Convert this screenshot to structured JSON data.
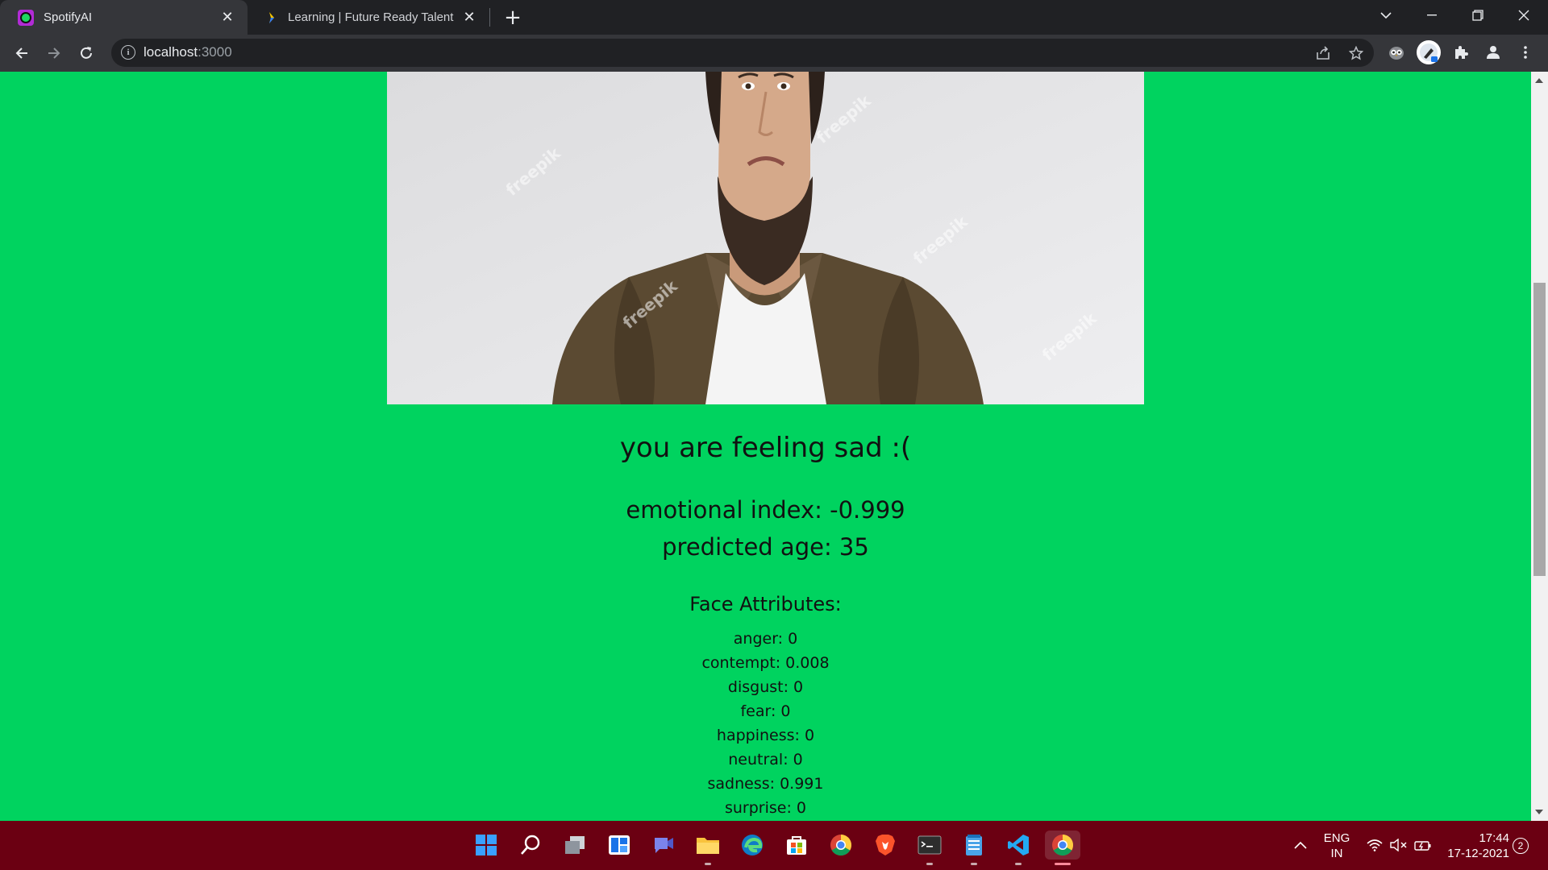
{
  "browser": {
    "tabs": [
      {
        "title": "SpotifyAI",
        "active": true,
        "favicon": "spotify-ai-icon"
      },
      {
        "title": "Learning | Future Ready Talent",
        "active": false,
        "favicon": "learning-icon"
      }
    ],
    "address": {
      "host": "localhost",
      "port": ":3000"
    }
  },
  "page": {
    "image": {
      "description_icon": "sad-man-photo",
      "watermark": "freepik"
    },
    "feeling": "you are feeling sad :(",
    "emotional_index": "emotional index: -0.999",
    "predicted_age": "predicted age: 35",
    "attributes_title": "Face Attributes:",
    "attributes": [
      "anger: 0",
      "contempt: 0.008",
      "disgust: 0",
      "fear: 0",
      "happiness: 0",
      "neutral: 0",
      "sadness: 0.991",
      "surprise: 0"
    ],
    "background_color": "#00d35f"
  },
  "taskbar": {
    "apps": [
      "start-icon",
      "search-icon",
      "task-view-icon",
      "widgets-icon",
      "teams-chat-icon",
      "file-explorer-icon",
      "edge-icon",
      "store-icon",
      "chrome-icon",
      "brave-icon",
      "terminal-icon",
      "notepad-icon",
      "vscode-icon",
      "chrome-active-icon"
    ],
    "language": {
      "line1": "ENG",
      "line2": "IN"
    },
    "clock": {
      "time": "17:44",
      "date": "17-12-2021"
    },
    "notifications": "2",
    "color": "#6b0012"
  }
}
